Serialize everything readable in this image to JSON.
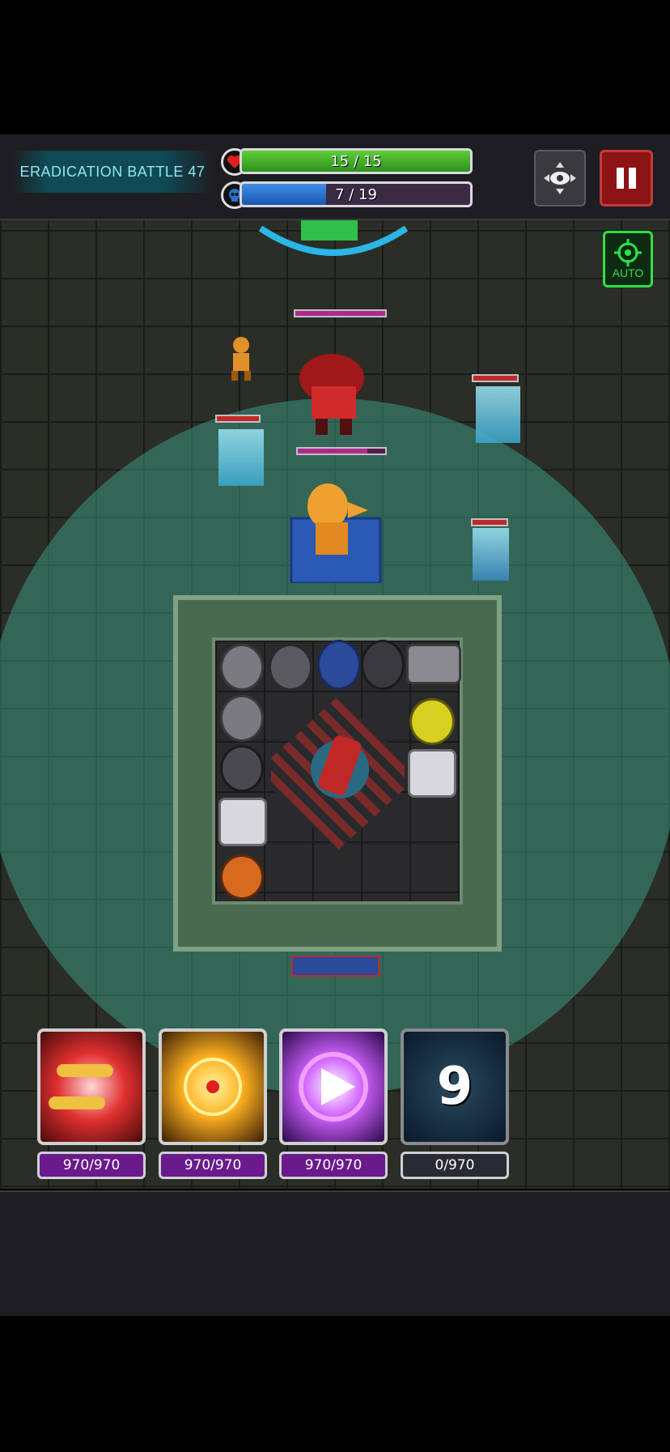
{
  "hud": {
    "stage_label": "ERADICATION BATTLE 47",
    "health": {
      "text": "15 / 15",
      "current": 15,
      "max": 15
    },
    "enemies": {
      "text": "7 / 19",
      "current": 7,
      "max": 19
    },
    "view_icon": "eye-move-icon",
    "pause_icon": "pause-icon"
  },
  "auto_button": {
    "label": "AUTO",
    "icon": "crosshair-icon"
  },
  "skills": [
    {
      "id": "bullet-barrage",
      "count": "970/970",
      "ready": true
    },
    {
      "id": "target-strike",
      "count": "970/970",
      "ready": true
    },
    {
      "id": "speed-boost",
      "count": "970/970",
      "ready": true
    },
    {
      "id": "vortex",
      "count": "0/970",
      "ready": false,
      "cooldown": "9"
    }
  ],
  "colors": {
    "health_fill": "#3fae28",
    "enemy_fill": "#2a6fd0",
    "pause_red": "#8c1414",
    "auto_green": "#2ee04a",
    "range_teal": "#40aa96"
  }
}
